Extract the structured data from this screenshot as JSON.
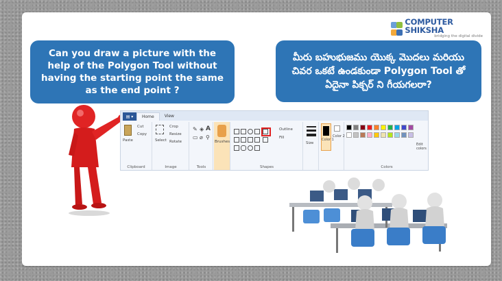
{
  "logo": {
    "name": "COMPUTER SHIKSHA",
    "tagline": "bridging the digital divide"
  },
  "question_en": "Can you draw a picture with the help of the Polygon Tool without having the starting point the same as the end point ?",
  "question_te": "మీరు బహుభుజము యొక్క మొదలు మరియు చివర ఒకటే ఉండకుండా Polygon Tool తో ఏదైనా పిక్చర్ ని గీయగలరా?",
  "ribbon": {
    "file_label": "▤ ▾",
    "tabs": [
      "Home",
      "View"
    ],
    "clipboard": {
      "paste": "Paste",
      "cut": "Cut",
      "copy": "Copy",
      "label": "Clipboard"
    },
    "image": {
      "select": "Select",
      "crop": "Crop",
      "resize": "Resize",
      "rotate": "Rotate",
      "label": "Image"
    },
    "tools": {
      "label": "Tools"
    },
    "brushes": "Brushes",
    "shapes": {
      "outline": "Outline",
      "fill": "Fill",
      "label": "Shapes"
    },
    "size": "Size",
    "color1": "Color 1",
    "color2": "Color 2",
    "colors_label": "Colors",
    "edit_colors": "Edit colors"
  },
  "colors": {
    "accent": "#2e75b6",
    "highlight": "#e02020",
    "palette": [
      "#000000",
      "#7f7f7f",
      "#880015",
      "#ed1c24",
      "#ff7f27",
      "#fff200",
      "#22b14c",
      "#00a2e8",
      "#3f48cc",
      "#a349a4",
      "#ffffff",
      "#c3c3c3",
      "#b97a57",
      "#ffaec9",
      "#ffc90e",
      "#efe4b0",
      "#b5e61d",
      "#99d9ea",
      "#7092be",
      "#c8bfe7"
    ]
  }
}
